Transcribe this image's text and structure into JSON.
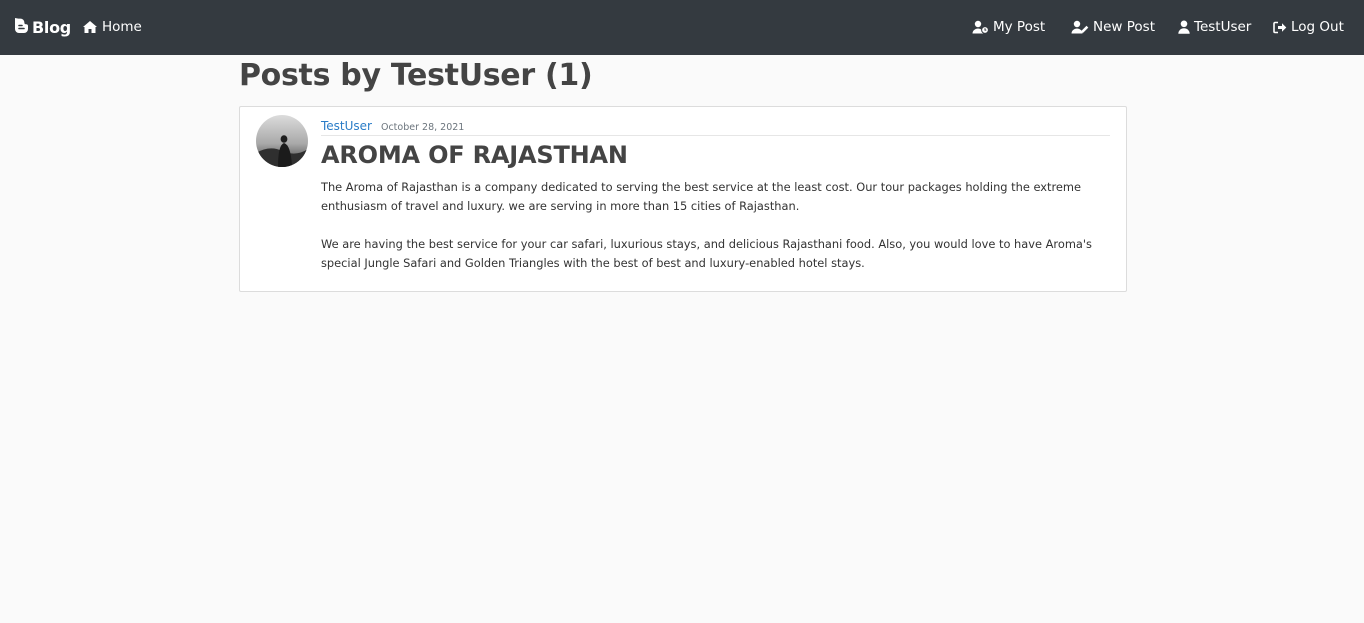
{
  "navbar": {
    "brand": {
      "label": "Blog",
      "icon": "blogger-icon"
    },
    "home": {
      "label": "Home",
      "icon": "home-icon"
    },
    "links": [
      {
        "label": "My Post",
        "icon": "user-clock-icon"
      },
      {
        "label": "New Post",
        "icon": "user-edit-icon"
      },
      {
        "label": "TestUser",
        "icon": "user-icon"
      },
      {
        "label": "Log Out",
        "icon": "sign-out-icon"
      }
    ]
  },
  "page": {
    "title": "Posts by TestUser (1)"
  },
  "posts": [
    {
      "author": "TestUser",
      "date": "October 28, 2021",
      "title": "AROMA OF RAJASTHAN",
      "paragraphs": [
        "The Aroma of Rajasthan is a company dedicated to serving the best service at the least cost. Our tour packages holding the extreme enthusiasm of travel and luxury. we are serving in more than 15 cities of Rajasthan.",
        "We are having the best service for your car safari, luxurious stays, and delicious Rajasthani food. Also, you would love to have Aroma's special Jungle Safari and Golden Triangles with the best of best and luxury-enabled hotel stays."
      ]
    }
  ],
  "colors": {
    "navbar_bg": "#343a40",
    "page_bg": "#fafafa",
    "link": "#2a7cc7"
  }
}
